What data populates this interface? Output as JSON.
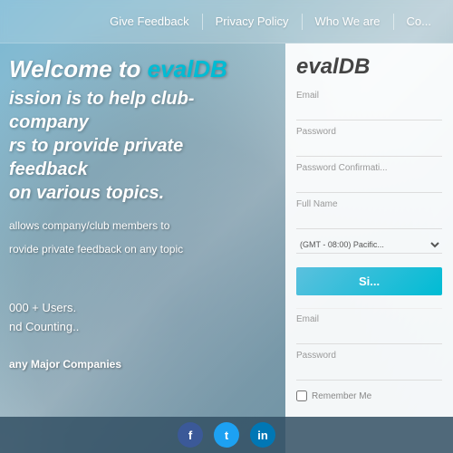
{
  "nav": {
    "items": [
      {
        "label": "Give Feedback",
        "id": "nav-give-feedback"
      },
      {
        "label": "Privacy Policy",
        "id": "nav-privacy-policy"
      },
      {
        "label": "Who We are",
        "id": "nav-who-we-are"
      },
      {
        "label": "Co...",
        "id": "nav-contact"
      }
    ]
  },
  "hero": {
    "welcome_prefix": "Welcome to ",
    "brand": "evalDB",
    "subtitle_line1": "ission is to help club-company",
    "subtitle_line2": "rs to provide private feedback",
    "subtitle_line3": "on various topics.",
    "desc1": "allows company/club members to",
    "desc2": "rovide private feedback on any topic",
    "stat1": "000 + Users.",
    "stat2": "nd Counting..",
    "companies": "any Major Companies"
  },
  "panel": {
    "logo_prefix": "eval",
    "logo_suffix": "DB",
    "signup_form": {
      "email_label": "Email",
      "email_placeholder": "",
      "password_label": "Password",
      "password_placeholder": "",
      "password_confirm_label": "Password Confirmati...",
      "fullname_label": "Full Name",
      "fullname_placeholder": "",
      "timezone_label": "(GMT - 08:00) Pacific...",
      "signup_btn": "Si..."
    },
    "login_form": {
      "email_label": "Email",
      "email_placeholder": "",
      "password_label": "Password",
      "password_placeholder": "",
      "remember_label": "Remember Me"
    }
  },
  "social": {
    "facebook": "f",
    "twitter": "t",
    "linkedin": "in"
  }
}
